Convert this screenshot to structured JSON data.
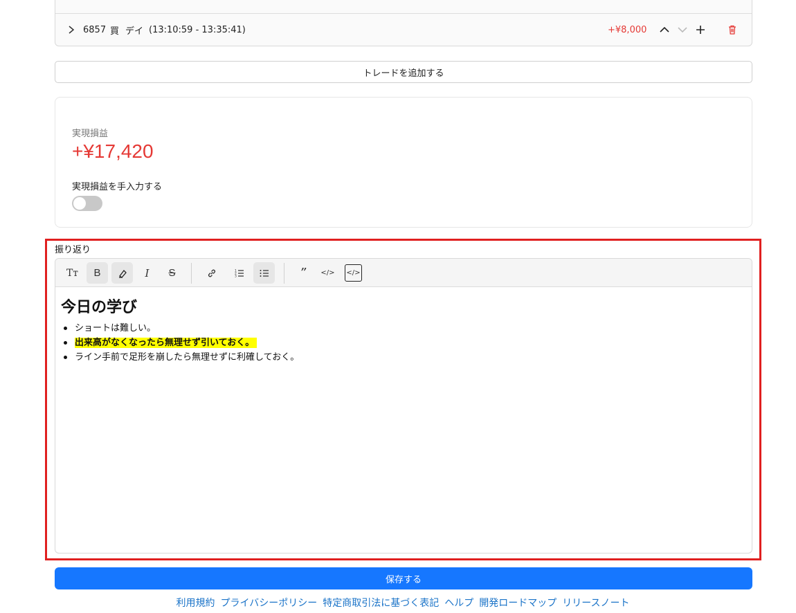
{
  "trade": {
    "code": "6857",
    "side": "買",
    "type": "デイ",
    "time": "(13:10:59 - 13:35:41)",
    "pl": "+¥8,000"
  },
  "add_trade_label": "トレードを追加する",
  "pl_card": {
    "label": "実現損益",
    "value": "+¥17,420",
    "manual_label": "実現損益を手入力する",
    "manual_enabled": false
  },
  "review": {
    "label": "振り返り",
    "toolbar": {
      "text_size": "Tт",
      "bold": "B",
      "italic": "I",
      "strike": "S",
      "quote": "”",
      "code": "</>",
      "code_block": "</>"
    },
    "heading": "今日の学び",
    "items": [
      "ショートは難しい。",
      "出来高がなくなったら無理せず引いておく。",
      "ライン手前で足形を崩したら無理せずに利確しておく。"
    ]
  },
  "save_label": "保存する",
  "footer": {
    "links": [
      "利用規約",
      "プライバシーポリシー",
      "特定商取引法に基づく表記",
      "ヘルプ",
      "開発ロードマップ",
      "リリースノート"
    ]
  },
  "colors": {
    "profit": "#e53935",
    "primary": "#1677ff",
    "highlight": "#ffff00",
    "frame": "#e02020"
  }
}
